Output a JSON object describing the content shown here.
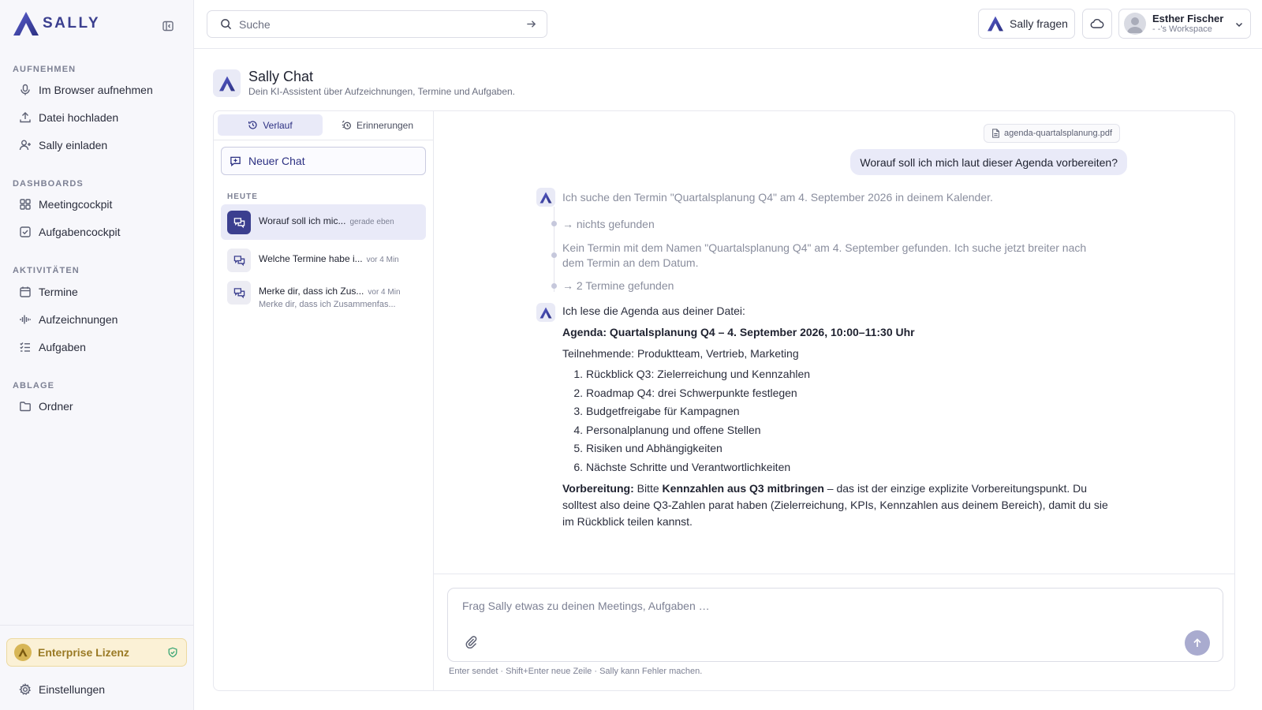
{
  "app": {
    "logo_text": "SALLY"
  },
  "sidebar": {
    "sections": [
      {
        "title": "AUFNEHMEN",
        "items": [
          {
            "label": "Im Browser aufnehmen",
            "icon": "microphone-icon"
          },
          {
            "label": "Datei hochladen",
            "icon": "upload-icon"
          },
          {
            "label": "Sally einladen",
            "icon": "user-plus-icon"
          }
        ]
      },
      {
        "title": "DASHBOARDS",
        "items": [
          {
            "label": "Meetingcockpit",
            "icon": "grid-icon"
          },
          {
            "label": "Aufgabencockpit",
            "icon": "checkbox-icon"
          }
        ]
      },
      {
        "title": "AKTIVITÄTEN",
        "items": [
          {
            "label": "Termine",
            "icon": "calendar-icon"
          },
          {
            "label": "Aufzeichnungen",
            "icon": "waveform-icon"
          },
          {
            "label": "Aufgaben",
            "icon": "checklist-icon"
          }
        ]
      },
      {
        "title": "ABLAGE",
        "items": [
          {
            "label": "Ordner",
            "icon": "folder-icon"
          }
        ]
      }
    ],
    "license_label": "Enterprise Lizenz",
    "settings_label": "Einstellungen"
  },
  "topbar": {
    "search_placeholder": "Suche",
    "ask_label": "Sally fragen",
    "user_name": "Esther Fischer",
    "workspace": "- -'s Workspace"
  },
  "header": {
    "title": "Sally Chat",
    "subtitle": "Dein KI-Assistent über Aufzeichnungen, Termine und Aufgaben."
  },
  "chat_panel": {
    "tabs": [
      "Verlauf",
      "Erinnerungen"
    ],
    "new_chat_label": "Neuer Chat",
    "group_label": "HEUTE",
    "items": [
      {
        "title": "Worauf soll ich mic...",
        "time": "gerade eben",
        "preview": ""
      },
      {
        "title": "Welche Termine habe i...",
        "time": "vor 4 Min",
        "preview": ""
      },
      {
        "title": "Merke dir, dass ich Zus...",
        "time": "vor 4 Min",
        "preview": "Merke dir, dass ich Zusammenfas..."
      }
    ]
  },
  "conversation": {
    "attachment": "agenda-quartalsplanung.pdf",
    "user_message": "Worauf soll ich mich laut dieser Agenda vorbereiten?",
    "step1": "Ich suche den Termin \"Quartalsplanung Q4\" am 4. September 2026 in deinem Kalender.",
    "step1_result": "→ nichts gefunden",
    "step2": "Kein Termin mit dem Namen \"Quartalsplanung Q4\" am 4. September gefunden. Ich suche jetzt breiter nach dem Termin an dem Datum.",
    "step2_result": "→ 2 Termine gefunden",
    "intro": "Ich lese die Agenda aus deiner Datei:",
    "agenda_heading": "Agenda: Quartalsplanung Q4 – 4. September 2026, 10:00–11:30 Uhr",
    "participants": "Teilnehmende: Produktteam, Vertrieb, Marketing",
    "agenda_items": [
      "Rückblick Q3: Zielerreichung und Kennzahlen",
      "Roadmap Q4: drei Schwerpunkte festlegen",
      "Budgetfreigabe für Kampagnen",
      "Personalplanung und offene Stellen",
      "Risiken und Abhängigkeiten",
      "Nächste Schritte und Verantwortlichkeiten"
    ],
    "prep_label": "Vorbereitung:",
    "prep_text1": " Bitte ",
    "prep_bold": "Kennzahlen aus Q3 mitbringen",
    "prep_text2": " – das ist der einzige explizite Vorbereitungspunkt. Du solltest also deine Q3-Zahlen parat haben (Zielerreichung, KPIs, Kennzahlen aus deinem Bereich), damit du sie im Rückblick teilen kannst."
  },
  "composer": {
    "placeholder": "Frag Sally etwas zu deinen Meetings, Aufgaben …",
    "hint": "Enter sendet · Shift+Enter neue Zeile · Sally kann Fehler machen."
  },
  "colors": {
    "brand": "#3b3f8f",
    "accent_bg": "#e9eaf8",
    "license_bg": "#fbf1d6"
  }
}
